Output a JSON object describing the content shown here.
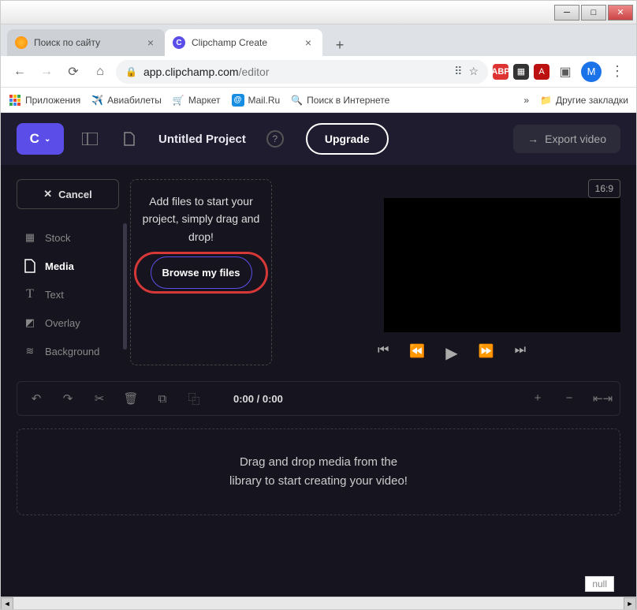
{
  "window": {
    "tabs": [
      {
        "title": "Поиск по сайту",
        "active": false
      },
      {
        "title": "Clipchamp Create",
        "active": true
      }
    ],
    "url_host": "app.clipchamp.com",
    "url_path": "/editor",
    "avatar_initial": "M",
    "bookmarks": [
      {
        "label": "Приложения"
      },
      {
        "label": "Авиабилеты"
      },
      {
        "label": "Маркет"
      },
      {
        "label": "Mail.Ru"
      },
      {
        "label": "Поиск в Интернете"
      }
    ],
    "bm_more": "»",
    "other_bookmarks": "Другие закладки"
  },
  "app": {
    "logo_text": "C",
    "project_title": "Untitled Project",
    "upgrade_label": "Upgrade",
    "export_label": "Export video",
    "cancel_label": "Cancel",
    "sidebar": [
      {
        "label": "Stock"
      },
      {
        "label": "Media"
      },
      {
        "label": "Text"
      },
      {
        "label": "Overlay"
      },
      {
        "label": "Background"
      }
    ],
    "media_panel_text": "Add files to start your project, simply drag and drop!",
    "browse_label": "Browse my files",
    "aspect": "16:9",
    "time_display": "0:00 / 0:00",
    "timeline_text_1": "Drag and drop media from the",
    "timeline_text_2": "library to start creating your video!",
    "null_label": "null"
  }
}
